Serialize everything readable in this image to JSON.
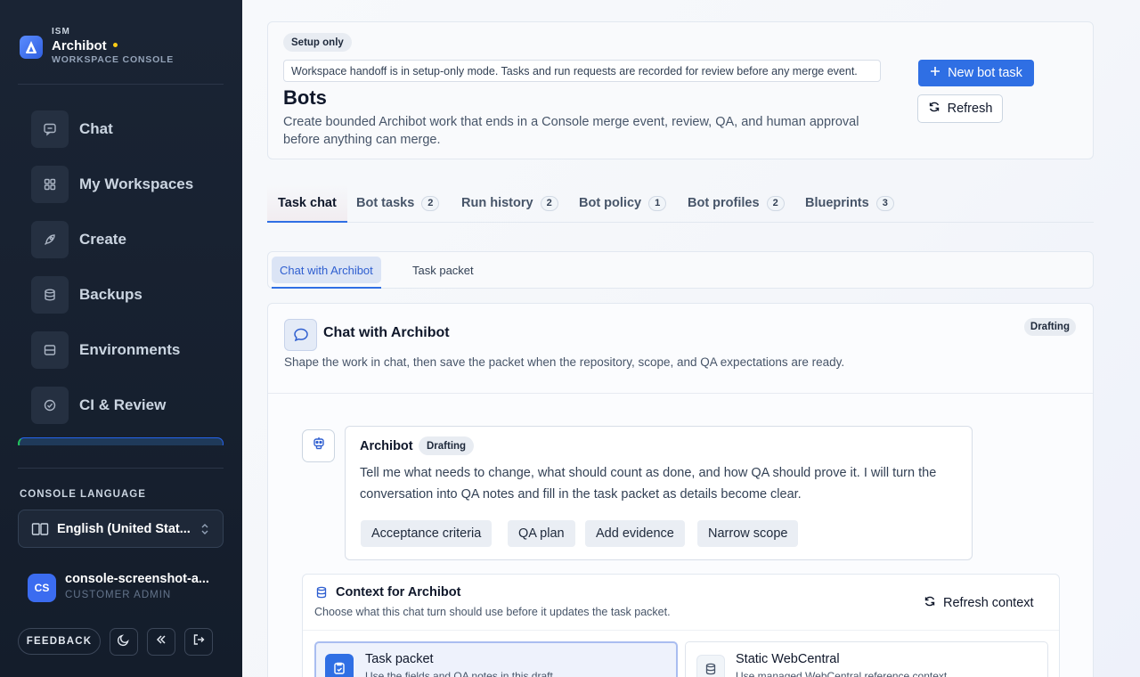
{
  "brand": {
    "eyebrow": "ISM",
    "name": "Archibot",
    "subtitle": "WORKSPACE CONSOLE"
  },
  "sidebar": {
    "items": [
      {
        "label": "Chat",
        "icon": "chat-bubble-icon"
      },
      {
        "label": "My Workspaces",
        "icon": "grid-icon"
      },
      {
        "label": "Create",
        "icon": "rocket-icon"
      },
      {
        "label": "Backups",
        "icon": "database-icon"
      },
      {
        "label": "Environments",
        "icon": "server-icon"
      },
      {
        "label": "CI & Review",
        "icon": "check-circle-icon"
      }
    ],
    "language_label": "CONSOLE LANGUAGE",
    "language_value": "English (United Stat...",
    "user": {
      "initials": "CS",
      "name": "console-screenshot-a...",
      "role": "CUSTOMER ADMIN"
    },
    "feedback_label": "FEEDBACK"
  },
  "header": {
    "badge": "Setup only",
    "notice": "Workspace handoff is in setup-only mode. Tasks and run requests are recorded for review before any merge event.",
    "title": "Bots",
    "description": "Create bounded Archibot work that ends in a Console merge event, review, QA, and human approval before anything can merge.",
    "primary_button": "New bot task",
    "secondary_button": "Refresh"
  },
  "tabs": [
    {
      "label": "Task chat",
      "count": null
    },
    {
      "label": "Bot tasks",
      "count": "2"
    },
    {
      "label": "Run history",
      "count": "2"
    },
    {
      "label": "Bot policy",
      "count": "1"
    },
    {
      "label": "Bot profiles",
      "count": "2"
    },
    {
      "label": "Blueprints",
      "count": "3"
    }
  ],
  "subtabs": [
    "Chat with Archibot",
    "Task packet"
  ],
  "chat": {
    "title": "Chat with Archibot",
    "status": "Drafting",
    "description": "Shape the work in chat, then save the packet when the repository, scope, and QA expectations are ready.",
    "message": {
      "author": "Archibot",
      "badge": "Drafting",
      "text": "Tell me what needs to change, what should count as done, and how QA should prove it. I will turn the conversation into QA notes and fill in the task packet as details become clear.",
      "chips": [
        "Acceptance criteria",
        "QA plan",
        "Add evidence",
        "Narrow scope"
      ]
    },
    "context": {
      "title": "Context for Archibot",
      "description": "Choose what this chat turn should use before it updates the task packet.",
      "refresh_label": "Refresh context",
      "options": [
        {
          "title": "Task packet",
          "description": "Use the fields and QA notes in this draft",
          "selected": true
        },
        {
          "title": "Static WebCentral",
          "description": "Use managed WebCentral reference context",
          "selected": false
        }
      ]
    }
  },
  "colors": {
    "accent": "#2f6fe4",
    "sidebar_bg": "#1a2434",
    "brand_dot": "#facc15"
  }
}
